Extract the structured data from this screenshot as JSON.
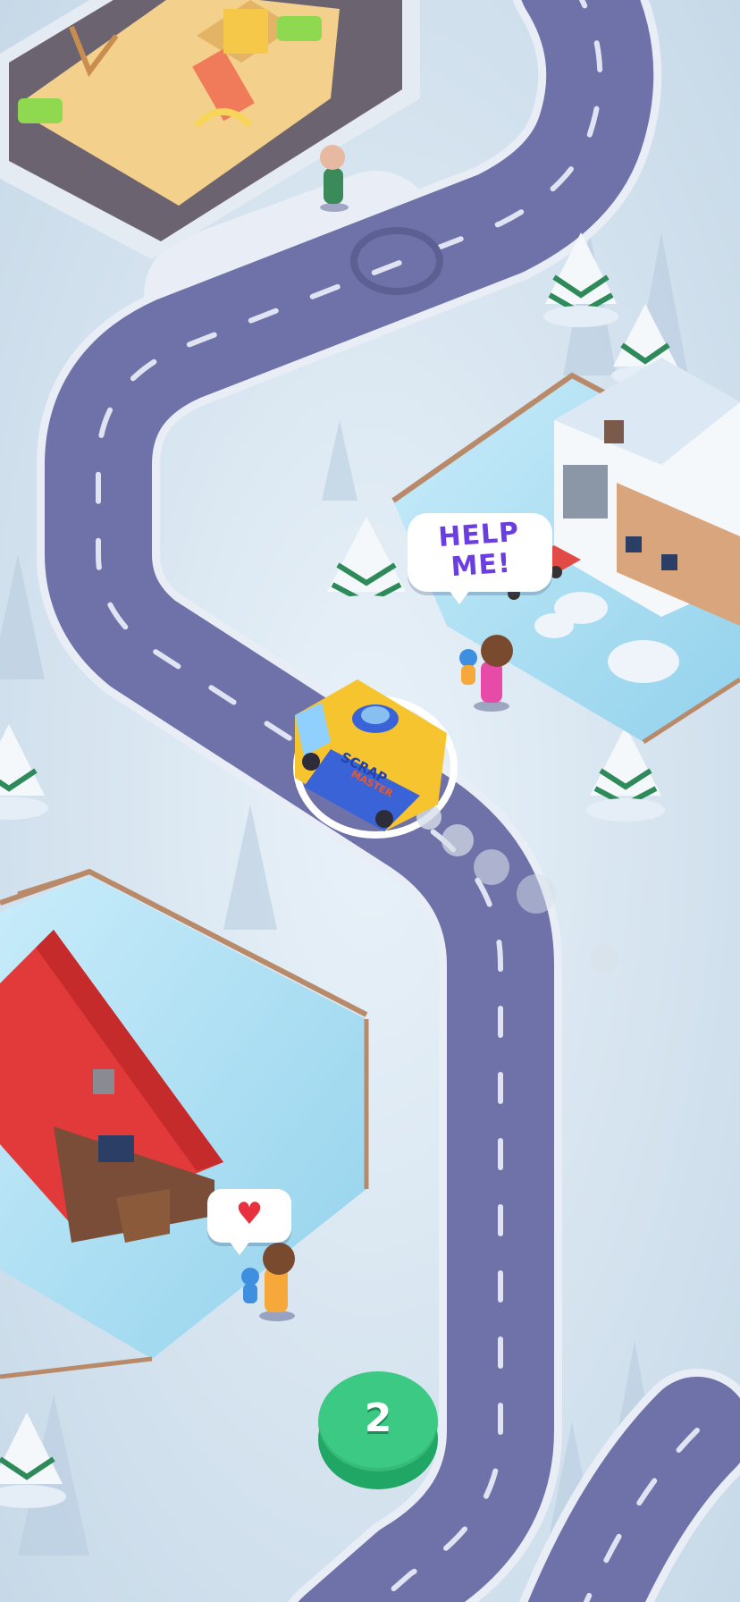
{
  "speech": {
    "help_text": "HELP\nME!",
    "heart_icon": "heart-icon"
  },
  "vehicle": {
    "brand_line1": "SCRAP",
    "brand_line2": "MASTER"
  },
  "level_button": {
    "number": "2"
  },
  "colors": {
    "road": "#6e72a8",
    "snow": "#dbe8f3",
    "ice": "#a8d8ee",
    "accent_green": "#3cc983",
    "help_text": "#6a3ee0",
    "heart": "#e8313f",
    "truck_yellow": "#f6c42e",
    "truck_blue": "#3a63d8"
  }
}
